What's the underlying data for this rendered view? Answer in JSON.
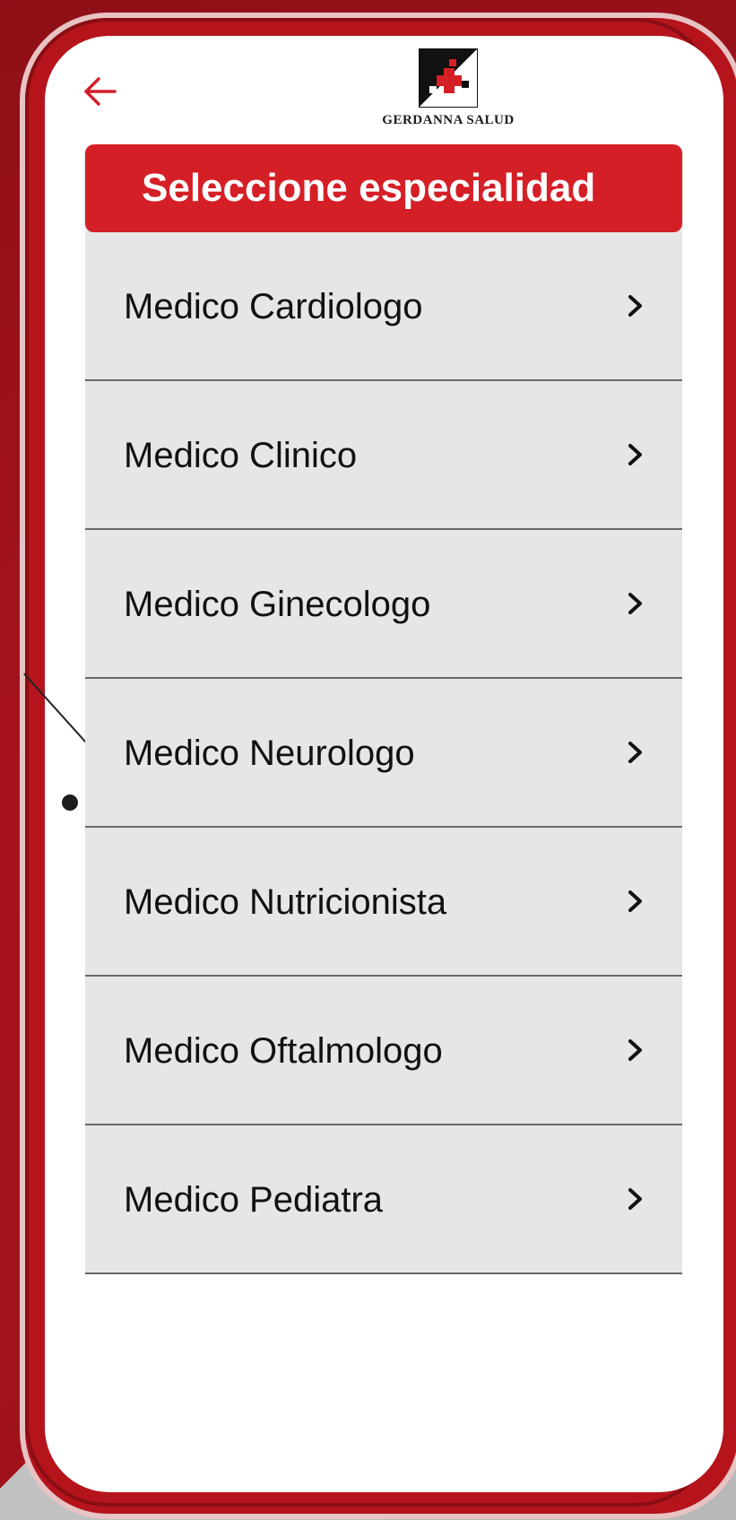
{
  "app": {
    "brand_name": "GERDANNA SALUD",
    "header_title": "Seleccione especialidad",
    "back_icon": "back-arrow-icon",
    "accent_color": "#d51f26"
  },
  "specialties": [
    {
      "label": "Medico Cardiologo",
      "icon": "chevron-right-icon"
    },
    {
      "label": "Medico Clinico",
      "icon": "chevron-right-icon"
    },
    {
      "label": "Medico Ginecologo",
      "icon": "chevron-right-icon"
    },
    {
      "label": "Medico Neurologo",
      "icon": "chevron-right-icon"
    },
    {
      "label": "Medico Nutricionista",
      "icon": "chevron-right-icon"
    },
    {
      "label": "Medico Oftalmologo",
      "icon": "chevron-right-icon"
    },
    {
      "label": "Medico Pediatra",
      "icon": "chevron-right-icon"
    }
  ]
}
